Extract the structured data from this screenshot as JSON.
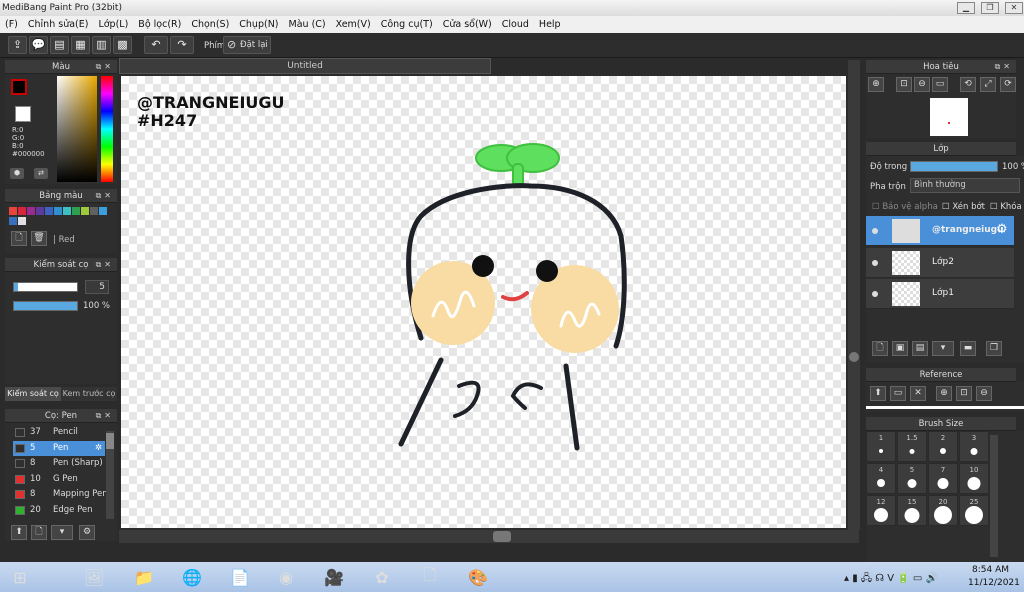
{
  "window": {
    "title": "MediBang Paint Pro (32bit)"
  },
  "menu": [
    "(F)",
    "Chỉnh sửa(E)",
    "Lớp(L)",
    "Bộ lọc(R)",
    "Chọn(S)",
    "Chụp(N)",
    "Màu (C)",
    "Xem(V)",
    "Công cụ(T)",
    "Cửa sổ(W)",
    "Cloud",
    "Help"
  ],
  "toolbar": {
    "shortcut_label": "Phím",
    "reset_label": "Đặt lại"
  },
  "color_panel": {
    "title": "Màu",
    "r": "R:0",
    "g": "G:0",
    "b": "B:0",
    "hex": "#000000"
  },
  "palette_panel": {
    "title": "Bảng màu",
    "selected": "Red",
    "swatches": [
      "#e8443c",
      "#d6263b",
      "#9c2a8f",
      "#5d3a9c",
      "#3d62c4",
      "#2f8fd0",
      "#3cc0c4",
      "#2fa050",
      "#a0c83c",
      "#606060",
      "#3c9edc",
      "#3a6fc0",
      "#e0e0e0"
    ]
  },
  "brush_control": {
    "title": "Kiểm soát cọ",
    "size": "5",
    "opacity": "100 %"
  },
  "tabs": {
    "brush_control": "Kiểm soát cọ",
    "color_mixer": "Kem trước cọ"
  },
  "brush_panel": {
    "title": "Cọ: Pen",
    "items": [
      {
        "size": "37",
        "name": "Pencil",
        "color": "#303030"
      },
      {
        "size": "5",
        "name": "Pen",
        "color": "#303030"
      },
      {
        "size": "8",
        "name": "Pen (Sharp)",
        "color": "#303030"
      },
      {
        "size": "10",
        "name": "G Pen",
        "color": "#e03030"
      },
      {
        "size": "8",
        "name": "Mapping Pen",
        "color": "#e03030"
      },
      {
        "size": "20",
        "name": "Edge Pen",
        "color": "#30b030"
      }
    ]
  },
  "document": {
    "tab_title": "Untitled",
    "watermark_line1": "@TRANGNEIUGU",
    "watermark_line2": "#H247"
  },
  "navigator": {
    "title": "Hoa tiêu"
  },
  "layer_panel": {
    "title": "Lớp",
    "opacity_label": "Độ trong",
    "opacity_value": "100 %",
    "blend_label": "Pha trộn",
    "blend_value": "Bình thường",
    "protect_alpha": "Bảo vệ alpha",
    "clipping": "Xén bớt",
    "lock": "Khóa",
    "layers": [
      {
        "name": "@trangneiugu",
        "active": true
      },
      {
        "name": "Lớp2",
        "active": false
      },
      {
        "name": "Lớp1",
        "active": false
      }
    ]
  },
  "reference": {
    "title": "Reference"
  },
  "brush_size": {
    "title": "Brush Size",
    "sizes": [
      "1",
      "1.5",
      "2",
      "3",
      "4",
      "5",
      "7",
      "10",
      "12",
      "15",
      "20",
      "25"
    ]
  },
  "taskbar": {
    "time": "8:54 AM",
    "date": "11/12/2021"
  }
}
